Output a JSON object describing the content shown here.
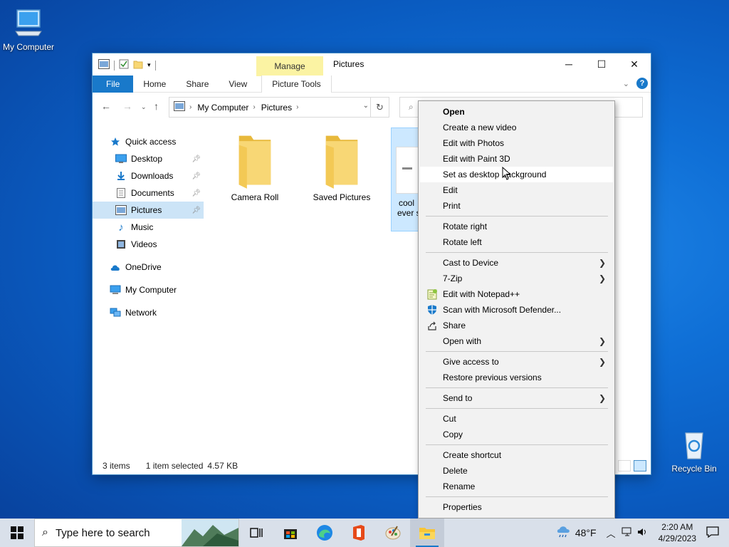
{
  "desktop": {
    "icons": [
      {
        "label": "My Computer"
      },
      {
        "label": "Recycle Bin"
      }
    ]
  },
  "window": {
    "title": "Pictures",
    "manage_tab": "Manage",
    "ribbon_tabs": [
      "File",
      "Home",
      "Share",
      "View",
      "Picture Tools"
    ],
    "breadcrumb": [
      "My Computer",
      "Pictures"
    ]
  },
  "navpane": {
    "items": [
      {
        "label": "Quick access",
        "icon": "star-icon"
      },
      {
        "label": "Desktop",
        "icon": "desktop-icon",
        "pinned": true
      },
      {
        "label": "Downloads",
        "icon": "download-icon",
        "pinned": true
      },
      {
        "label": "Documents",
        "icon": "document-icon",
        "pinned": true
      },
      {
        "label": "Pictures",
        "icon": "pictures-icon",
        "pinned": true,
        "selected": true
      },
      {
        "label": "Music",
        "icon": "music-icon"
      },
      {
        "label": "Videos",
        "icon": "video-icon"
      },
      {
        "label": "OneDrive",
        "icon": "cloud-icon"
      },
      {
        "label": "My Computer",
        "icon": "computer-icon"
      },
      {
        "label": "Network",
        "icon": "network-icon"
      }
    ]
  },
  "content": {
    "items": [
      {
        "label": "Camera Roll",
        "type": "folder"
      },
      {
        "label": "Saved Pictures",
        "type": "folder"
      },
      {
        "label_line1": "cool",
        "label_line2": "ever s",
        "type": "image",
        "selected": true
      }
    ]
  },
  "status": {
    "count": "3 items",
    "selection": "1 item selected",
    "size": "4.57 KB"
  },
  "context_menu": {
    "items": [
      {
        "label": "Open",
        "bold": true
      },
      {
        "label": "Create a new video"
      },
      {
        "label": "Edit with Photos"
      },
      {
        "label": "Edit with Paint 3D"
      },
      {
        "label": "Set as desktop background",
        "hover": true
      },
      {
        "label": "Edit"
      },
      {
        "label": "Print"
      },
      {
        "separator": true
      },
      {
        "label": "Rotate right"
      },
      {
        "label": "Rotate left"
      },
      {
        "separator": true
      },
      {
        "label": "Cast to Device",
        "submenu": true
      },
      {
        "label": "7-Zip",
        "submenu": true
      },
      {
        "label": "Edit with Notepad++",
        "icon": "notepadpp-icon"
      },
      {
        "label": "Scan with Microsoft Defender...",
        "icon": "defender-icon"
      },
      {
        "label": "Share",
        "icon": "share-icon"
      },
      {
        "label": "Open with",
        "submenu": true
      },
      {
        "separator": true
      },
      {
        "label": "Give access to",
        "submenu": true
      },
      {
        "label": "Restore previous versions"
      },
      {
        "separator": true
      },
      {
        "label": "Send to",
        "submenu": true
      },
      {
        "separator": true
      },
      {
        "label": "Cut"
      },
      {
        "label": "Copy"
      },
      {
        "separator": true
      },
      {
        "label": "Create shortcut"
      },
      {
        "label": "Delete"
      },
      {
        "label": "Rename"
      },
      {
        "separator": true
      },
      {
        "label": "Properties"
      }
    ]
  },
  "taskbar": {
    "search_placeholder": "Type here to search",
    "weather": "48°F",
    "time": "2:20 AM",
    "date": "4/29/2023"
  },
  "colors": {
    "accent": "#1979ca",
    "menu_bg": "#f2f2f2",
    "folder_yellow": "#f8d775",
    "selection_bg": "#cce8ff"
  }
}
